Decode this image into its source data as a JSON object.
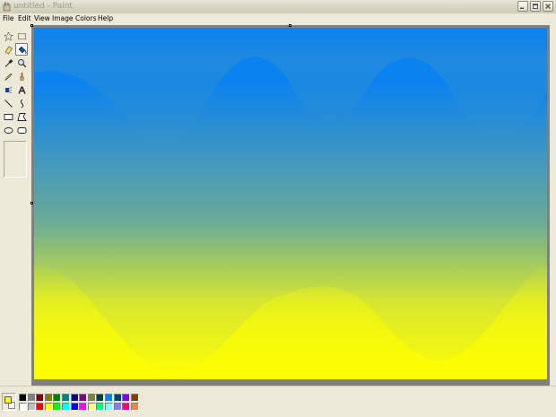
{
  "window": {
    "title": "untitled - Paint",
    "icon": "paint-app-icon",
    "controls": [
      "minimize-icon",
      "maximize-icon",
      "close-icon"
    ]
  },
  "menu": {
    "items": [
      "File",
      "Edit",
      "View",
      "Image",
      "Colors",
      "Help"
    ]
  },
  "toolbox": {
    "tools": [
      {
        "name": "free-form-select-icon",
        "selected": false
      },
      {
        "name": "rectangle-select-icon",
        "selected": false
      },
      {
        "name": "eraser-icon",
        "selected": false
      },
      {
        "name": "fill-with-color-icon",
        "selected": true
      },
      {
        "name": "pick-color-icon",
        "selected": false
      },
      {
        "name": "magnifier-icon",
        "selected": false
      },
      {
        "name": "pencil-icon",
        "selected": false
      },
      {
        "name": "brush-icon",
        "selected": false
      },
      {
        "name": "airbrush-icon",
        "selected": false
      },
      {
        "name": "text-icon",
        "selected": false
      },
      {
        "name": "line-icon",
        "selected": false
      },
      {
        "name": "curve-icon",
        "selected": false
      },
      {
        "name": "rectangle-icon",
        "selected": false
      },
      {
        "name": "polygon-icon",
        "selected": false
      },
      {
        "name": "ellipse-icon",
        "selected": false
      },
      {
        "name": "rounded-rectangle-icon",
        "selected": false
      }
    ]
  },
  "canvas": {
    "top_color": "#0a82f0",
    "middle_color": "#6aaa96",
    "bottom_color": "#ffff00"
  },
  "palette": {
    "foreground": "#ffff00",
    "background": "#ffffff",
    "row1": [
      "#000000",
      "#808080",
      "#800000",
      "#808000",
      "#008000",
      "#008080",
      "#000080",
      "#800080",
      "#808040",
      "#004040",
      "#0080ff",
      "#004080",
      "#8000ff",
      "#804000"
    ],
    "row2": [
      "#ffffff",
      "#c0c0c0",
      "#ff0000",
      "#ffff00",
      "#00ff00",
      "#00ffff",
      "#0000ff",
      "#ff00ff",
      "#ffff80",
      "#00ff80",
      "#80ffff",
      "#8080ff",
      "#ff0080",
      "#ff8040"
    ]
  }
}
